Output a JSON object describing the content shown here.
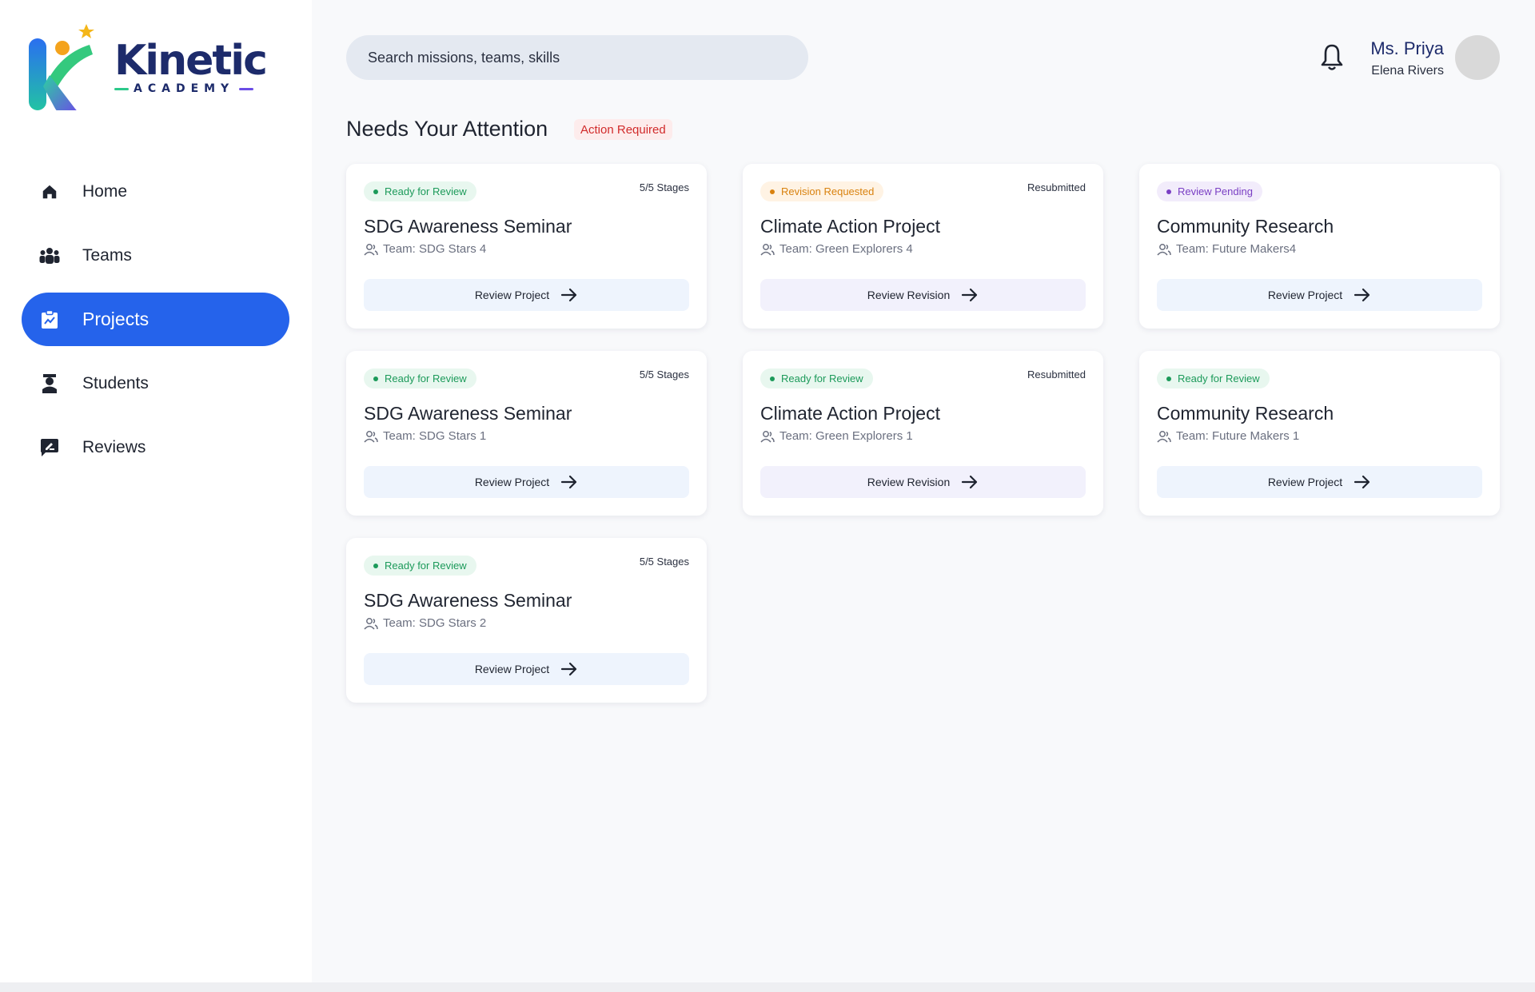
{
  "brand": {
    "name": "Kinetic",
    "tagline": "ACADEMY"
  },
  "sidebar": {
    "items": [
      {
        "label": "Home",
        "icon": "home-icon",
        "active": false
      },
      {
        "label": "Teams",
        "icon": "teams-icon",
        "active": false
      },
      {
        "label": "Projects",
        "icon": "projects-icon",
        "active": true
      },
      {
        "label": "Students",
        "icon": "student-icon",
        "active": false
      },
      {
        "label": "Reviews",
        "icon": "reviews-icon",
        "active": false
      }
    ]
  },
  "header": {
    "search_placeholder": "Search missions, teams, skills",
    "user_name": "Ms. Priya",
    "user_sub": "Elena Rivers"
  },
  "section": {
    "title": "Needs Your Attention",
    "badge": "Action Required"
  },
  "cards": [
    {
      "status": "Ready for Review",
      "status_kind": "ready",
      "meta": "5/5 Stages",
      "title": "SDG Awareness Seminar",
      "team": "Team: SDG Stars 4",
      "button": "Review Project"
    },
    {
      "status": "Revision Requested",
      "status_kind": "revision",
      "meta": "Resubmitted",
      "title": "Climate Action Project",
      "team": "Team: Green Explorers 4",
      "button": "Review Revision"
    },
    {
      "status": "Review Pending",
      "status_kind": "pending",
      "meta": "",
      "title": "Community Research",
      "team": "Team: Future Makers4",
      "button": "Review Project"
    },
    {
      "status": "Ready for Review",
      "status_kind": "ready",
      "meta": "5/5 Stages",
      "title": "SDG Awareness Seminar",
      "team": "Team: SDG Stars 1",
      "button": "Review Project"
    },
    {
      "status": "Ready for Review",
      "status_kind": "ready",
      "meta": "Resubmitted",
      "title": "Climate Action Project",
      "team": "Team: Green Explorers 1",
      "button": "Review Revision"
    },
    {
      "status": "Ready for Review",
      "status_kind": "ready",
      "meta": "",
      "title": "Community Research",
      "team": "Team: Future Makers 1",
      "button": "Review Project"
    },
    {
      "status": "Ready for Review",
      "status_kind": "ready",
      "meta": "5/5 Stages",
      "title": "SDG Awareness Seminar",
      "team": "Team: SDG Stars 2",
      "button": "Review Project"
    }
  ],
  "colors": {
    "accent": "#2563eb",
    "brand_navy": "#1d2b6b",
    "ready": "#1c9a5a",
    "revision": "#d9820f",
    "pending": "#7a3fc4",
    "alert": "#d12b2b"
  }
}
